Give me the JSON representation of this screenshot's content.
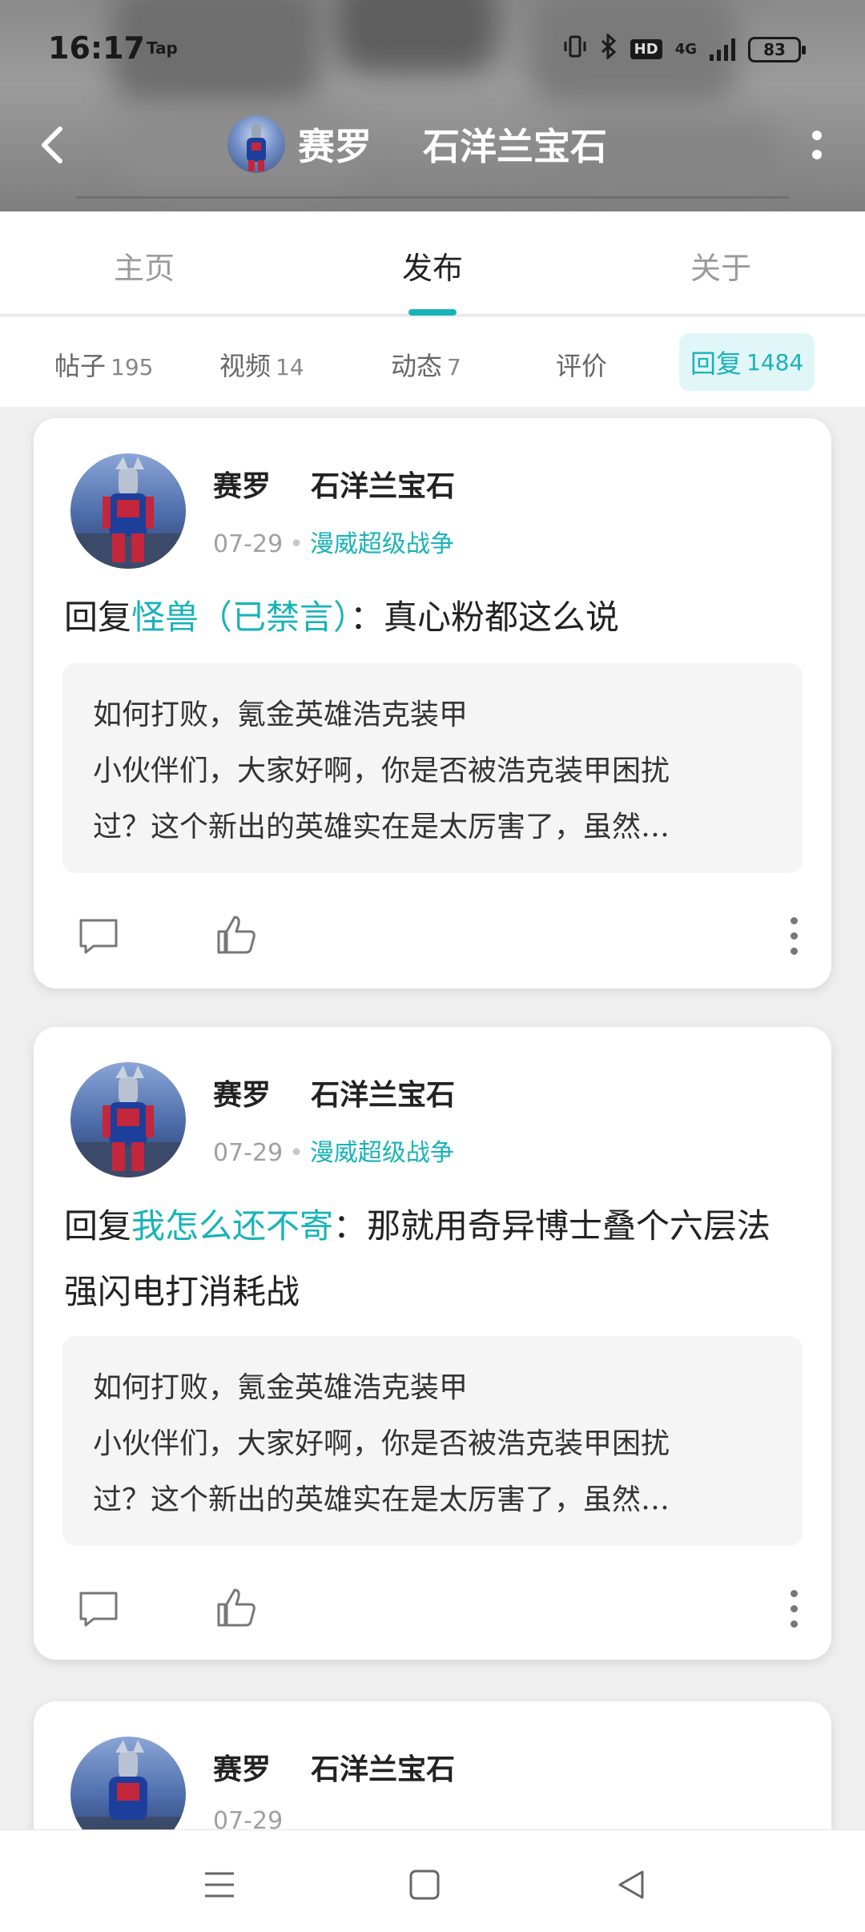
{
  "status_bar": {
    "time": "16:17",
    "app_indicator": "Tap",
    "hd": "HD",
    "network": "4G",
    "battery": "83",
    "icons": [
      "vibrate-icon",
      "bluetooth-icon",
      "hd-icon",
      "signal-icon",
      "battery-icon"
    ]
  },
  "header": {
    "user_name": "赛罗    石洋兰宝石",
    "back_icon": "back-arrow-icon",
    "more_icon": "more-vertical-icon"
  },
  "tabs": [
    {
      "label": "主页",
      "active": false
    },
    {
      "label": "发布",
      "active": true
    },
    {
      "label": "关于",
      "active": false
    }
  ],
  "subtabs": [
    {
      "label": "帖子",
      "count": "195",
      "active": false
    },
    {
      "label": "视频",
      "count": "14",
      "active": false
    },
    {
      "label": "动态",
      "count": "7",
      "active": false
    },
    {
      "label": "评价",
      "count": "",
      "active": false
    },
    {
      "label": "回复",
      "count": "1484",
      "active": true
    }
  ],
  "accent_color": "#18b3b8",
  "posts": [
    {
      "author": "赛罗    石洋兰宝石",
      "date": "07-29",
      "game": "漫威超级战争",
      "reply_prefix": "回复",
      "reply_target": "怪兽（已禁言）",
      "reply_text": "：真心粉都这么说",
      "quote_title": "如何打败，氪金英雄浩克装甲",
      "quote_line1": "小伙伴们，大家好啊，你是否被浩克装甲困扰",
      "quote_line2": "过？这个新出的英雄实在是太厉害了，虽然…"
    },
    {
      "author": "赛罗    石洋兰宝石",
      "date": "07-29",
      "game": "漫威超级战争",
      "reply_prefix": "回复",
      "reply_target": "我怎么还不寄",
      "reply_text": "：那就用奇异博士叠个六层法强闪电打消耗战",
      "quote_title": "如何打败，氪金英雄浩克装甲",
      "quote_line1": "小伙伴们，大家好啊，你是否被浩克装甲困扰",
      "quote_line2": "过？这个新出的英雄实在是太厉害了，虽然…"
    },
    {
      "author": "赛罗    石洋兰宝石",
      "date": "07-29"
    }
  ],
  "navbar": {
    "icons": [
      "menu-icon",
      "home-square-icon",
      "back-triangle-icon"
    ]
  }
}
